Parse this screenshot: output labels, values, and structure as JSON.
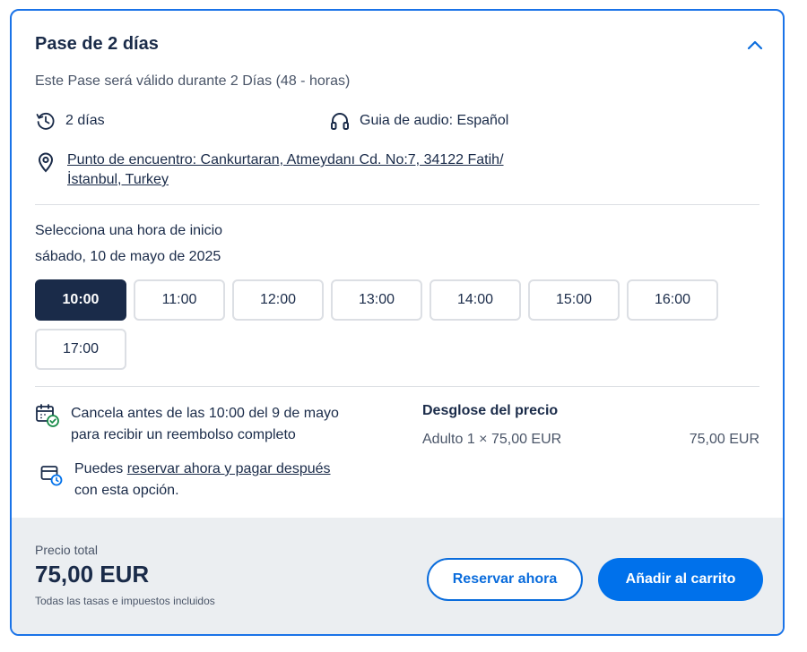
{
  "pass": {
    "title": "Pase de 2 días",
    "subtitle": "Este Pase será válido durante 2 Días (48 - horas)",
    "duration": "2 días",
    "audio_guide": "Guia de audio: Español",
    "meeting_point_line1": "Punto de encuentro: Cankurtaran, Atmeydanı Cd. No:7, 34122 Fatih/",
    "meeting_point_line2": "İstanbul, Turkey"
  },
  "schedule": {
    "heading": "Selecciona una hora de inicio",
    "date": "sábado, 10 de mayo de 2025",
    "selected": "10:00",
    "times": [
      "10:00",
      "11:00",
      "12:00",
      "13:00",
      "14:00",
      "15:00",
      "16:00",
      "17:00"
    ]
  },
  "policies": {
    "cancel_line1": "Cancela antes de las 10:00 del 9 de mayo",
    "cancel_line2": "para recibir un reembolso completo",
    "reserve_prefix": "Puedes ",
    "reserve_link": "reservar ahora y pagar después",
    "reserve_suffix": "con esta opción."
  },
  "breakdown": {
    "title": "Desglose del precio",
    "item_label": "Adulto 1 × 75,00 EUR",
    "item_amount": "75,00 EUR"
  },
  "footer": {
    "total_label": "Precio total",
    "total_value": "75,00 EUR",
    "taxes_note": "Todas las tasas e impuestos incluidos",
    "reserve_button": "Reservar ahora",
    "cart_button": "Añadir al carrito"
  },
  "icons": {
    "chevron": "chevron-up-icon",
    "duration": "clock-history-icon",
    "audio": "headphones-icon",
    "location": "map-pin-icon",
    "calendar": "calendar-check-icon",
    "reserve": "card-clock-icon"
  },
  "colors": {
    "accent": "#0071eb",
    "border": "#1a73e8",
    "selected_time": "#1a2b49",
    "footer_bg": "#ebeef1"
  }
}
